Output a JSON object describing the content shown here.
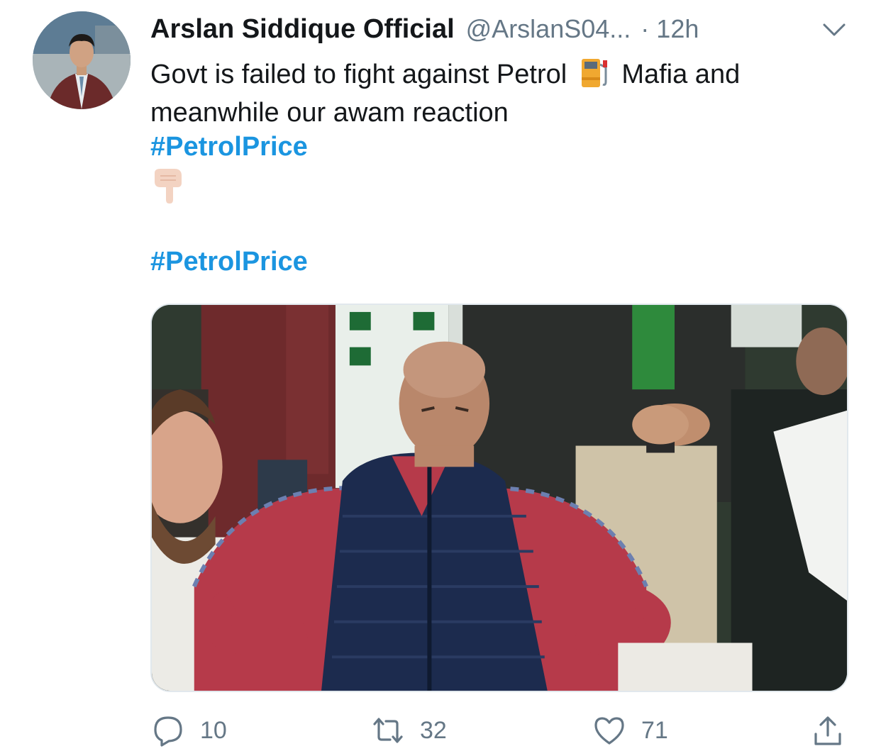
{
  "tweet": {
    "author_name": "Arslan Siddique Official",
    "author_handle": "@ArslanS04...",
    "separator": "·",
    "timestamp": "12h",
    "text_before_emoji": "Govt is failed to fight against Petrol",
    "text_after_emoji": "Mafia and meanwhile our awam reaction",
    "hashtag_1": "#PetrolPrice",
    "hashtag_2": "#PetrolPrice",
    "inline_emoji": "fuel-pump-icon",
    "pointing_emoji": "backhand-index-pointing-down-icon"
  },
  "actions": {
    "replies": "10",
    "retweets": "32",
    "likes": "71"
  },
  "colors": {
    "link": "#1b95e0",
    "secondary": "#657786",
    "text": "#14171a"
  }
}
